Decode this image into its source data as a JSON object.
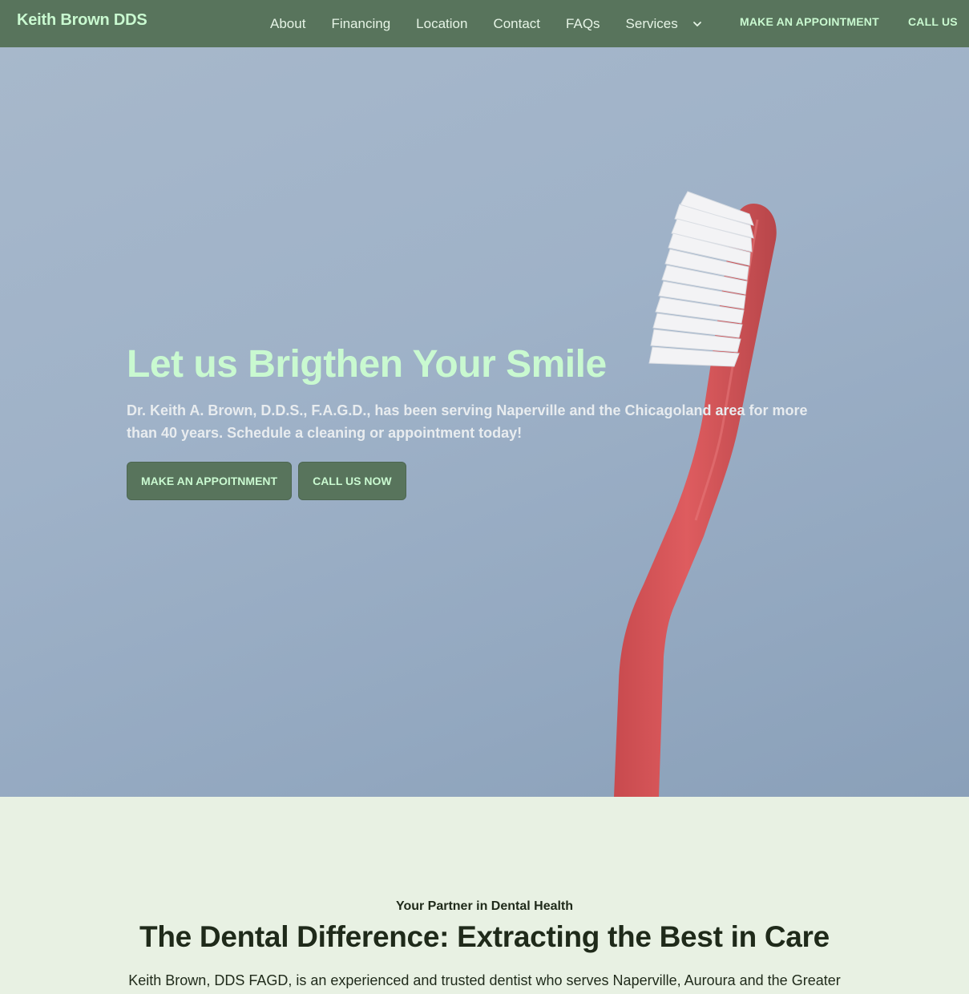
{
  "nav": {
    "brand": "Keith Brown DDS",
    "links": [
      "About",
      "Financing",
      "Location",
      "Contact",
      "FAQs",
      "Services"
    ],
    "appointment_label": "MAKE AN APPOINTMENT",
    "call_label": "CALL US",
    "services_icon": "chevron-down-icon"
  },
  "hero": {
    "title": "Let us Brigthen Your Smile",
    "subtitle": "Dr. Keith A. Brown, D.D.S., F.A.G.D., has been serving Naperville and the Chicagoland area for more than 40 years. Schedule a cleaning or appointment today!",
    "primary_button": "MAKE AN APPOITNMENT",
    "secondary_button": "CALL US NOW",
    "image": "toothbrush-photo"
  },
  "section": {
    "eyebrow": "Your Partner in Dental Health",
    "title": "The Dental Difference: Extracting the Best in Care",
    "text": "Keith Brown, DDS FAGD, is an experienced and trusted dentist who serves Naperville, Auroura and the Greater"
  },
  "colors": {
    "nav_bg": "#58745c",
    "accent": "#c9f9d0",
    "hero_bg": "#9fb2c8",
    "section_bg": "#e8f1e3",
    "text_dark": "#1f2a1a"
  }
}
